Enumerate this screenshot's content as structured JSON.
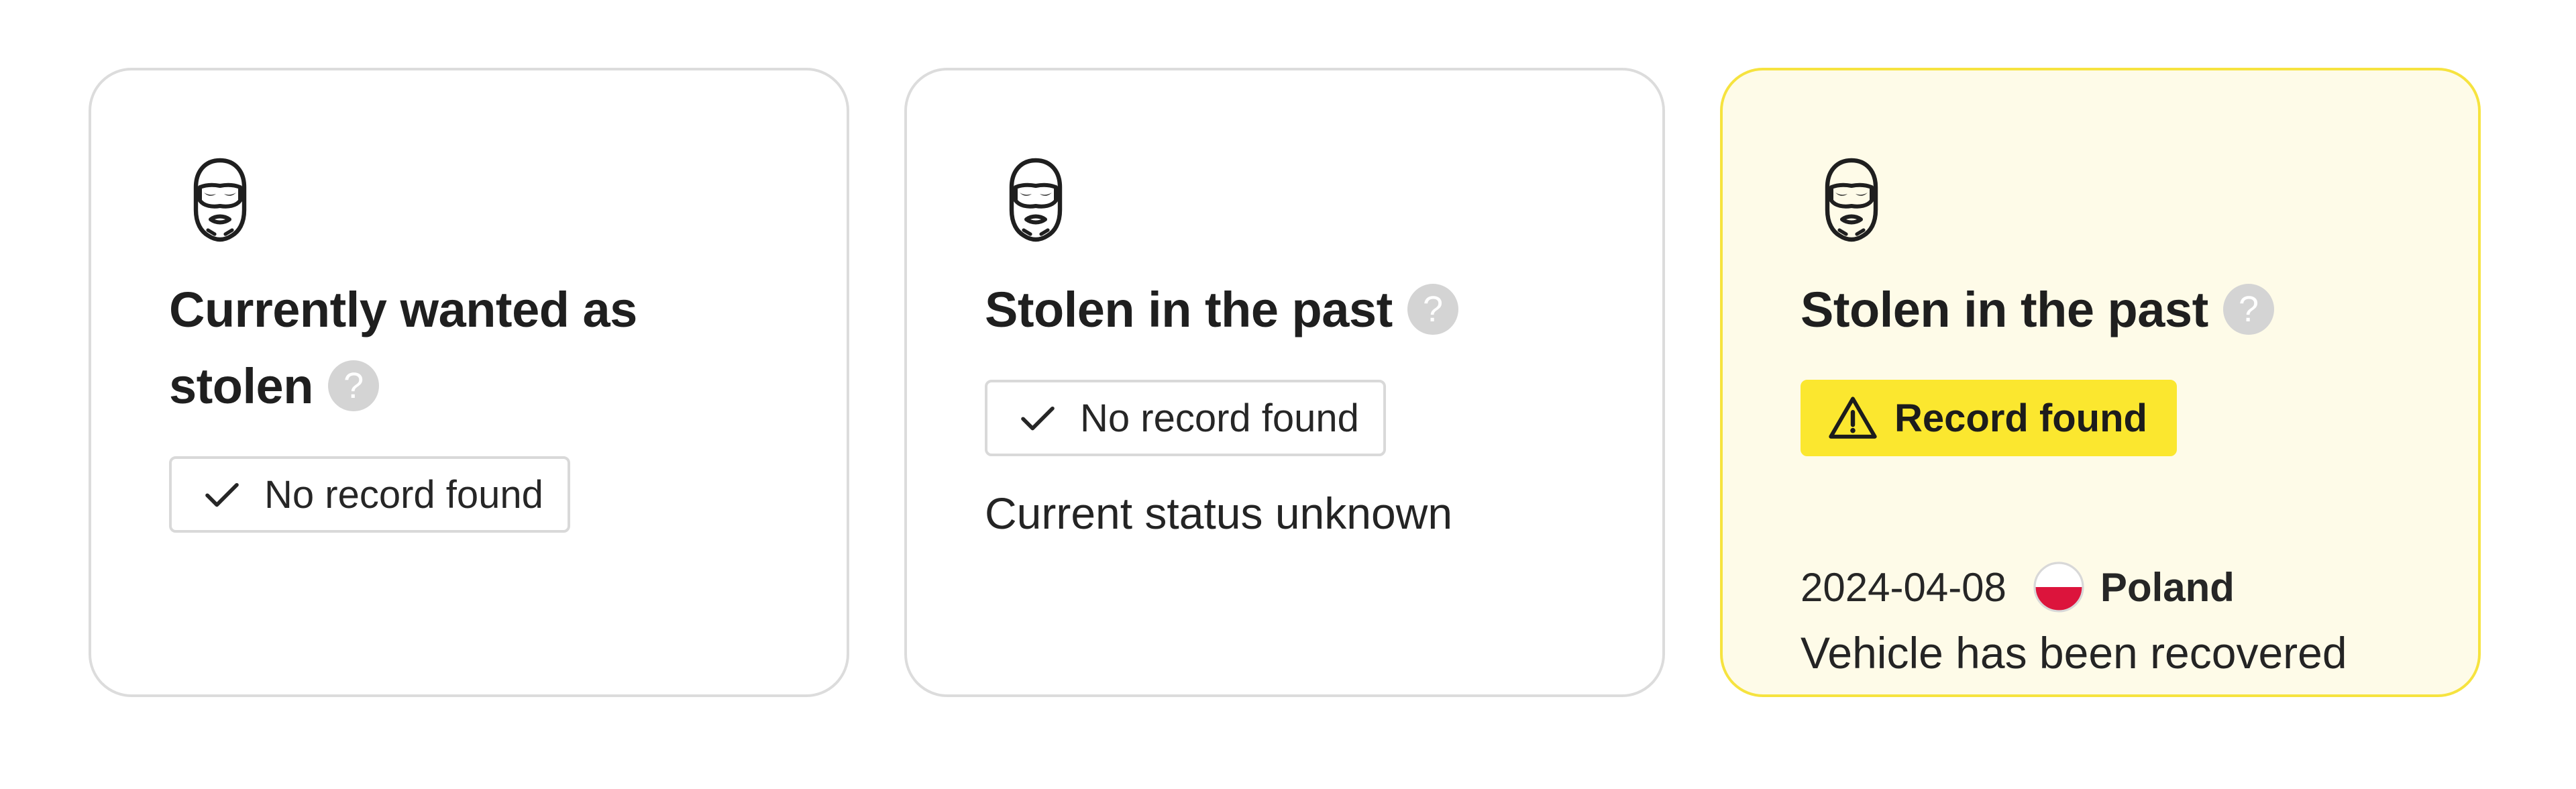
{
  "cards": [
    {
      "icon": "balaclava-icon",
      "title": "Currently wanted as stolen",
      "help": "?",
      "badge": {
        "icon": "check-icon",
        "label": "No record found"
      }
    },
    {
      "icon": "balaclava-icon",
      "title": "Stolen in the past",
      "help": "?",
      "badge": {
        "icon": "check-icon",
        "label": "No record found"
      },
      "status": "Current status unknown"
    },
    {
      "icon": "balaclava-icon",
      "title": "Stolen in the past",
      "help": "?",
      "badge": {
        "icon": "warning-icon",
        "label": "Record found"
      },
      "record": {
        "date": "2024-04-08",
        "flag_icon": "poland-flag-icon",
        "country": "Poland",
        "status": "Vehicle has been recovered"
      }
    }
  ],
  "colors": {
    "card_border": "#dcdcdc",
    "highlight_background": "#fefbe8",
    "highlight_border": "#f6e33f",
    "badge_found": "#fbe72f",
    "help_icon": "#d4d4d4",
    "flag_red": "#dc143c"
  }
}
